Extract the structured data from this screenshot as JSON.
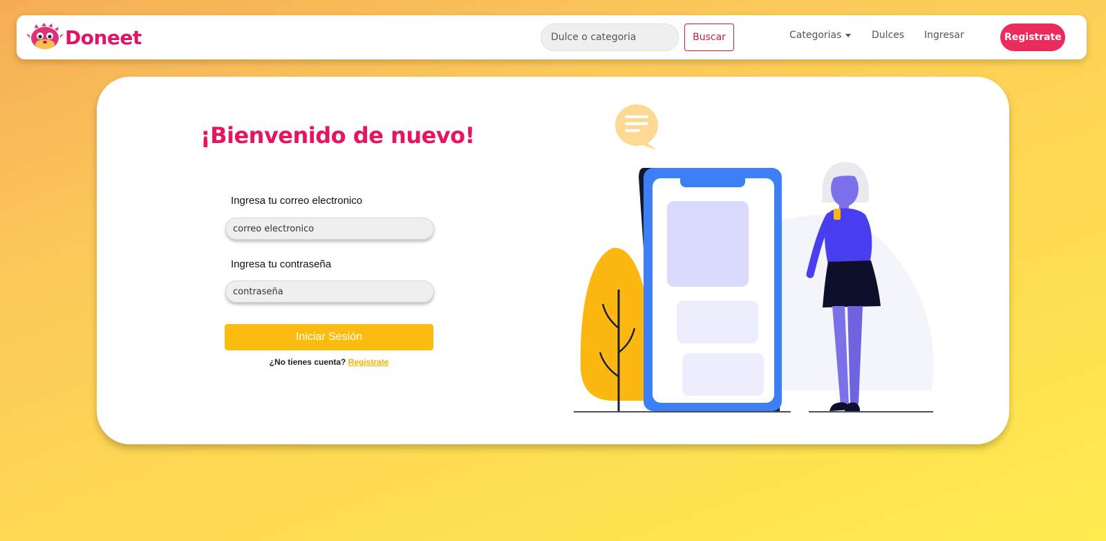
{
  "navbar": {
    "brand": "Doneet",
    "search": {
      "placeholder": "Dulce o categoria",
      "value": "",
      "button_label": "Buscar"
    },
    "links": {
      "categories": "Categorias",
      "sweets": "Dulces",
      "login": "Ingresar",
      "register": "Registrate"
    }
  },
  "login_form": {
    "title": "¡Bienvenido de nuevo!",
    "email_label": "Ingresa tu correo electronico",
    "email_placeholder": "correo electronico",
    "password_label": "Ingresa tu contraseña",
    "password_placeholder": "contraseña",
    "submit_label": "Iniciar Sesión",
    "no_account_text": "¿No tienes cuenta?",
    "register_link": "Registrate"
  },
  "colors": {
    "brand": "#e0156a",
    "accent_pink": "#ea2b5b",
    "accent_yellow": "#fcbc0f",
    "phone_blue": "#3d7ff5",
    "figure_purple": "#4a3ff0"
  },
  "icons": {
    "logo": "pufferfish-mascot-icon",
    "chat": "chat-bubble-icon"
  }
}
